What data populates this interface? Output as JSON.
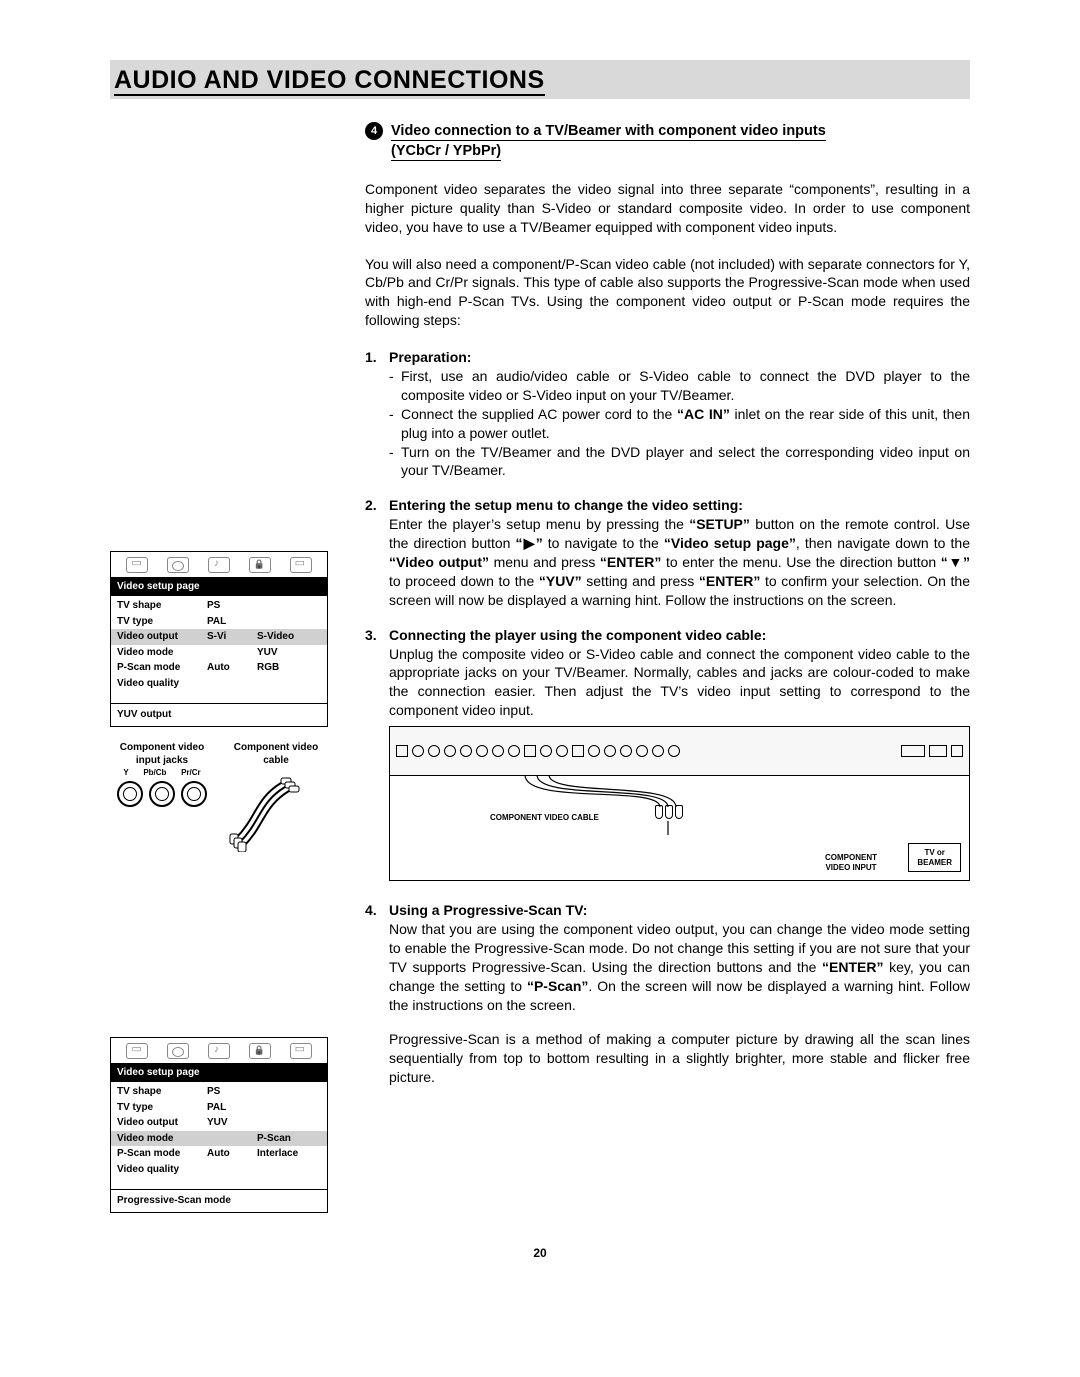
{
  "page_title": "AUDIO AND VIDEO CONNECTIONS",
  "section": {
    "number": "4",
    "title_line1": "Video connection to a TV/Beamer with component video inputs",
    "title_line2": "(YCbCr / YPbPr)"
  },
  "paragraphs": {
    "intro1": "Component video separates the video signal into three separate “components”, resulting in a higher picture quality than S-Video or standard composite video. In order to use component video, you have to use a TV/Beamer equipped with component video inputs.",
    "intro2": "You will also need a component/P-Scan video cable (not included) with separate connectors for Y, Cb/Pb and Cr/Pr signals. This type of cable also supports the Progressive-Scan mode when used with high-end P-Scan TVs. Using the component video output or P-Scan mode requires the following steps:"
  },
  "steps": [
    {
      "title": "Preparation:",
      "dash_items": [
        "First, use an audio/video cable or S-Video cable to connect the DVD player to the composite video or S-Video input on your TV/Beamer.",
        "Connect the supplied AC power cord to the <b>“AC IN”</b> inlet on the rear side of this unit, then plug into a power outlet.",
        "Turn on the TV/Beamer and the DVD player and select the corresponding video input on your TV/Beamer."
      ]
    },
    {
      "title": "Entering the setup menu to change the video setting:",
      "body": "Enter the player’s setup menu by pressing the <b>“SETUP”</b> button on the remote control. Use the direction button <b>“▶”</b> to navigate to the <b>“Video setup page”</b>, then navigate down to the <b>“Video output”</b> menu and press <b>“ENTER”</b> to enter the menu. Use the direction button <b>“▼”</b> to proceed down to the <b>“YUV”</b> setting and press <b>“ENTER”</b> to confirm your selection. On the screen will now be displayed a warning hint. Follow the instructions on the screen."
    },
    {
      "title": "Connecting the player using the component video cable:",
      "body": "Unplug the composite video or S-Video cable and connect the component video cable to the appropriate jacks on your TV/Beamer. Normally, cables and jacks are colour-coded to make the connection easier. Then adjust the TV’s video input setting to correspond to the component video input."
    },
    {
      "title": "Using a Progressive-Scan TV:",
      "body": "Now that you are using the component video output, you can change the video mode setting to enable the Progressive-Scan mode. Do not change this setting if you are not sure that your TV supports Progressive-Scan. Using the direction buttons and the <b>“ENTER”</b> key, you can change the setting to <b>“P-Scan”</b>. On the screen will now be displayed a warning hint. Follow the instructions on the screen.",
      "body2": "Progressive-Scan is a method of making a computer picture by drawing all the scan lines sequentially from top to bottom resulting in a slightly brighter, more stable and flicker free picture."
    }
  ],
  "setup1": {
    "header": "Video setup page",
    "rows": [
      {
        "c1": "TV shape",
        "c2": "PS",
        "c3": "",
        "hl": false
      },
      {
        "c1": "TV type",
        "c2": "PAL",
        "c3": "",
        "hl": false
      },
      {
        "c1": "Video output",
        "c2": "S-Vi",
        "c3": "S-Video",
        "hl": true
      },
      {
        "c1": "Video mode",
        "c2": "",
        "c3": "YUV",
        "hl": false
      },
      {
        "c1": "P-Scan mode",
        "c2": "Auto",
        "c3": "RGB",
        "hl": false
      },
      {
        "c1": "Video quality",
        "c2": "",
        "c3": "",
        "hl": false
      }
    ],
    "footer": "YUV output"
  },
  "setup2": {
    "header": "Video setup page",
    "rows": [
      {
        "c1": "TV shape",
        "c2": "PS",
        "c3": "",
        "hl": false
      },
      {
        "c1": "TV type",
        "c2": "PAL",
        "c3": "",
        "hl": false
      },
      {
        "c1": "Video output",
        "c2": "YUV",
        "c3": "",
        "hl": false
      },
      {
        "c1": "Video mode",
        "c2": "",
        "c3": "P-Scan",
        "hl": true
      },
      {
        "c1": "P-Scan mode",
        "c2": "Auto",
        "c3": "Interlace",
        "hl": false
      },
      {
        "c1": "Video quality",
        "c2": "",
        "c3": "",
        "hl": false
      }
    ],
    "footer": "Progressive-Scan mode"
  },
  "component": {
    "left_label1": "Component video",
    "left_label2": "input jacks",
    "right_label1": "Component video",
    "right_label2": "cable",
    "jacks": [
      "Y",
      "Pb/Cb",
      "Pr/Cr"
    ]
  },
  "diagram": {
    "cable_label": "COMPONENT VIDEO CABLE",
    "input_label1": "COMPONENT",
    "input_label2": "VIDEO INPUT",
    "tv_label1": "TV or",
    "tv_label2": "BEAMER"
  },
  "page_number": "20"
}
